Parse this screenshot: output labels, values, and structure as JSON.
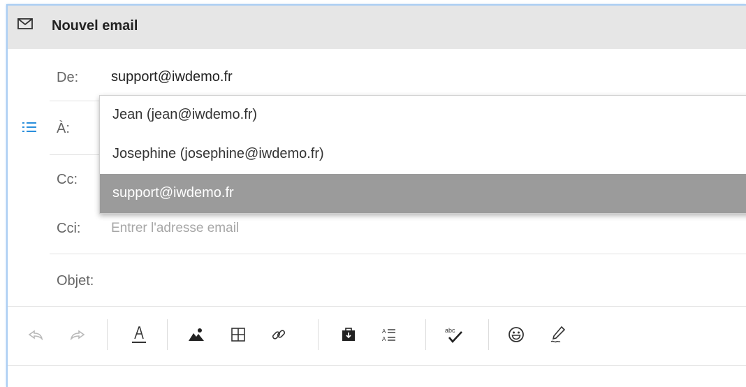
{
  "header": {
    "title": "Nouvel email",
    "icon": "mail-icon"
  },
  "fields": {
    "from": {
      "label": "De:",
      "value": "support@iwdemo.fr"
    },
    "to": {
      "label": "À:"
    },
    "cc": {
      "label": "Cc:"
    },
    "bcc": {
      "label": "Cci:",
      "placeholder": "Entrer l'adresse email"
    },
    "subject": {
      "label": "Objet:"
    }
  },
  "suggestions": [
    {
      "label": "Jean (jean@iwdemo.fr)",
      "selected": false
    },
    {
      "label": "Josephine (josephine@iwdemo.fr)",
      "selected": false
    },
    {
      "label": "support@iwdemo.fr",
      "selected": true
    }
  ],
  "toolbar": {
    "buttons": [
      "undo-icon",
      "redo-icon",
      "font-color-icon",
      "image-icon",
      "table-icon",
      "link-icon",
      "insert-template-icon",
      "list-format-icon",
      "spellcheck-icon",
      "emoji-icon",
      "signature-icon"
    ]
  },
  "colors": {
    "accent": "#2a8fdc",
    "selected_bg": "#9b9b9b",
    "header_bg": "#e6e6e6",
    "border": "#a9cdf3"
  }
}
